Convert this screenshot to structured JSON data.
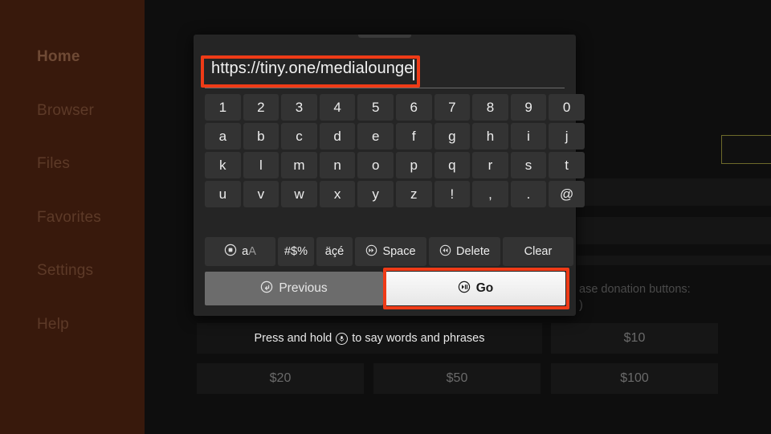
{
  "sidebar": {
    "background_color": "#38190c",
    "items": [
      {
        "label": "Home",
        "icon": "home-icon",
        "active": true
      },
      {
        "label": "Browser",
        "icon": "browser-icon",
        "active": false
      },
      {
        "label": "Files",
        "icon": "files-icon",
        "active": false
      },
      {
        "label": "Favorites",
        "icon": "favorites-icon",
        "active": false
      },
      {
        "label": "Settings",
        "icon": "settings-icon",
        "active": false
      },
      {
        "label": "Help",
        "icon": "help-icon",
        "active": false
      }
    ]
  },
  "background": {
    "note_line_1": "ase donation buttons:",
    "note_line_2": ")",
    "voice_hint": "Press and hold     to say words and phrases",
    "voice_hint_prefix": "Press and hold",
    "voice_hint_suffix": "to say words and phrases",
    "mic_icon": "microphone-icon",
    "focus_border_color": "#6d6a2a",
    "donation_buttons": [
      {
        "label": "$10"
      },
      {
        "label": "$20"
      },
      {
        "label": "$50"
      },
      {
        "label": "$100"
      }
    ]
  },
  "keyboard_dialog": {
    "url_input": {
      "value": "https://tiny.one/medialounge",
      "placeholder": "",
      "highlighted": true
    },
    "highlight_color": "#ef3b17",
    "keys": [
      "1",
      "2",
      "3",
      "4",
      "5",
      "6",
      "7",
      "8",
      "9",
      "0",
      "a",
      "b",
      "c",
      "d",
      "e",
      "f",
      "g",
      "h",
      "i",
      "j",
      "k",
      "l",
      "m",
      "n",
      "o",
      "p",
      "q",
      "r",
      "s",
      "t",
      "u",
      "v",
      "w",
      "x",
      "y",
      "z",
      "!",
      ",",
      ".",
      "@"
    ],
    "function_keys": [
      {
        "label": "aA",
        "icon": "circle-stop-icon",
        "case_primary": "a",
        "case_secondary": "A"
      },
      {
        "label": "#$%",
        "icon": ""
      },
      {
        "label": "äçé",
        "icon": ""
      },
      {
        "label": "Space",
        "icon": "circle-forward-icon"
      },
      {
        "label": "Delete",
        "icon": "circle-rewind-icon"
      },
      {
        "label": "Clear",
        "icon": ""
      }
    ],
    "actions": {
      "previous": {
        "label": "Previous",
        "icon": "circle-back-icon",
        "highlighted": false
      },
      "go": {
        "label": "Go",
        "icon": "circle-playpause-icon",
        "highlighted": true
      }
    }
  }
}
